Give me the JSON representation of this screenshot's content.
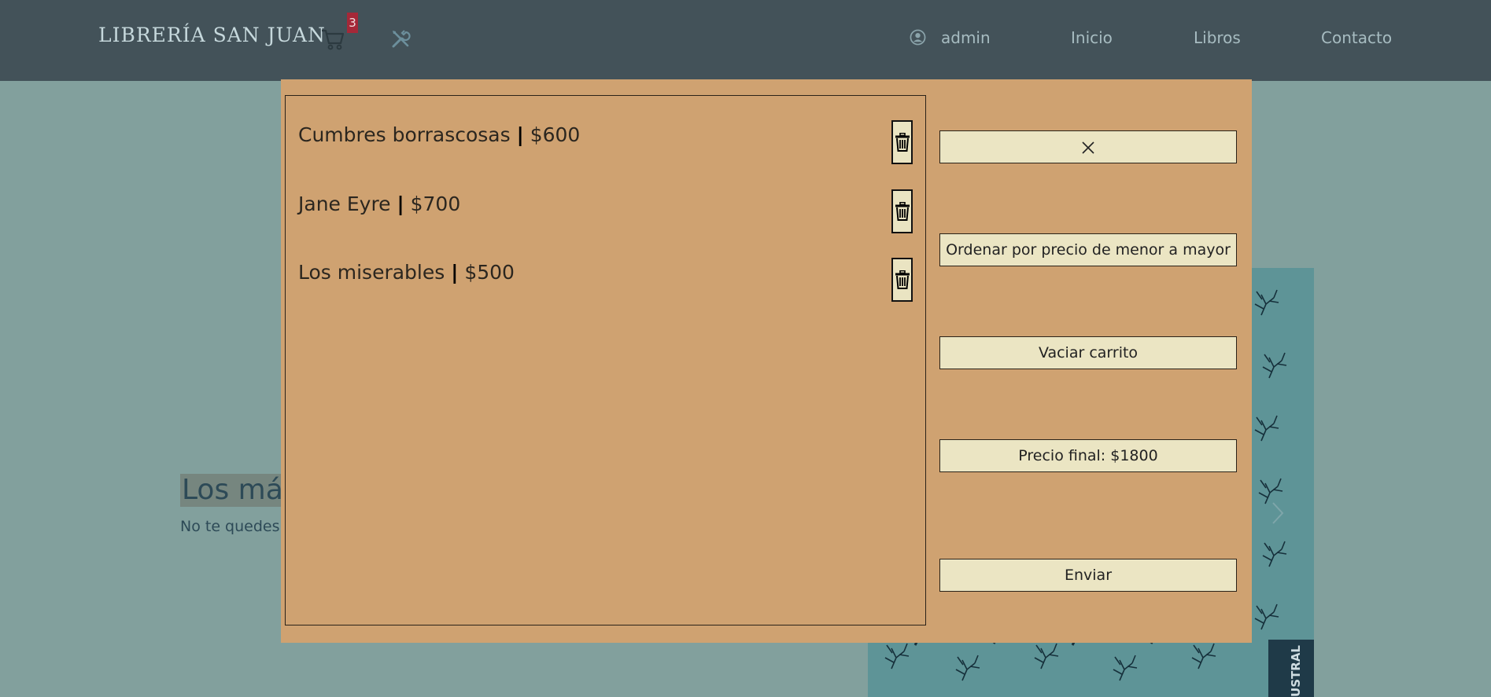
{
  "navbar": {
    "brand": "LIBRERÍA SAN JUAN",
    "cart_count": "3",
    "user": "admin",
    "links": [
      "Inicio",
      "Libros",
      "Contacto"
    ],
    "icons": {
      "cart": "cart-icon",
      "tools": "tools-icon",
      "user": "user-circle-icon"
    },
    "colors": {
      "background": "#435259",
      "badge": "#a52838"
    }
  },
  "background_page": {
    "heading_partial": "Los más",
    "subtext_partial": "No te quedes",
    "cover_spine_text": "AUSTRAL"
  },
  "cart_modal": {
    "items": [
      {
        "title": "Cumbres borrascosas",
        "separator": "|",
        "price": "$600"
      },
      {
        "title": "Jane Eyre",
        "separator": "|",
        "price": "$700"
      },
      {
        "title": "Los miserables",
        "separator": "|",
        "price": "$500"
      }
    ],
    "close_label": "×",
    "sort_label": "Ordenar por precio de menor a mayor",
    "empty_label": "Vaciar carrito",
    "total_label": "Precio final: $1800",
    "send_label": "Enviar",
    "colors": {
      "modal_bg": "#cfa271",
      "button_bg": "#ebe5c3"
    }
  }
}
